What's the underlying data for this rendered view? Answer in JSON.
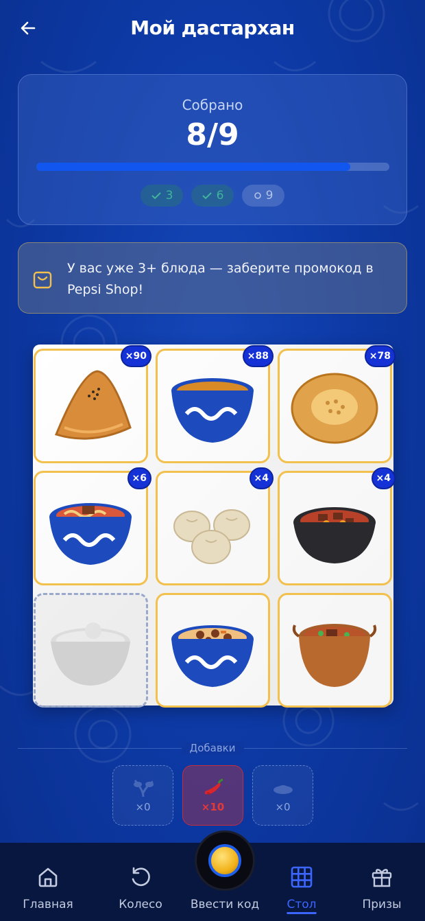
{
  "header": {
    "title": "Мой дастархан"
  },
  "progress": {
    "label": "Собрано",
    "value_text": "8/9",
    "collected": 8,
    "total": 9,
    "fill_fraction": 0.89,
    "milestones": [
      {
        "label": "3",
        "status": "done"
      },
      {
        "label": "6",
        "status": "done"
      },
      {
        "label": "9",
        "status": "pending"
      }
    ]
  },
  "promo": {
    "text": "У вас уже 3+ блюда — заберите промокод в Pepsi Shop!"
  },
  "dishes": [
    {
      "name": "samsa",
      "count": "×90"
    },
    {
      "name": "tea-bowl",
      "count": "×88"
    },
    {
      "name": "non-bread",
      "count": "×78"
    },
    {
      "name": "lagman",
      "count": "×6"
    },
    {
      "name": "manti",
      "count": "×4"
    },
    {
      "name": "kazan-kebab",
      "count": "×4"
    },
    {
      "name": "plov-pot",
      "count": ""
    },
    {
      "name": "plov-bowl",
      "count": ""
    },
    {
      "name": "shurpa",
      "count": ""
    }
  ],
  "additions": {
    "label": "Добавки",
    "items": [
      {
        "icon": "herbs-icon",
        "count": "×0"
      },
      {
        "icon": "chili-pepper-icon",
        "count": "×10"
      },
      {
        "icon": "spice-icon",
        "count": "×0"
      }
    ]
  },
  "nav": {
    "home": "Главная",
    "wheel": "Колесо",
    "enter_code": "Ввести код",
    "table": "Стол",
    "prizes": "Призы"
  },
  "colors": {
    "accent": "#1256f0",
    "gold_border": "#f2c04d",
    "badge": "#1532d6",
    "nav_active": "#3d66ff"
  }
}
